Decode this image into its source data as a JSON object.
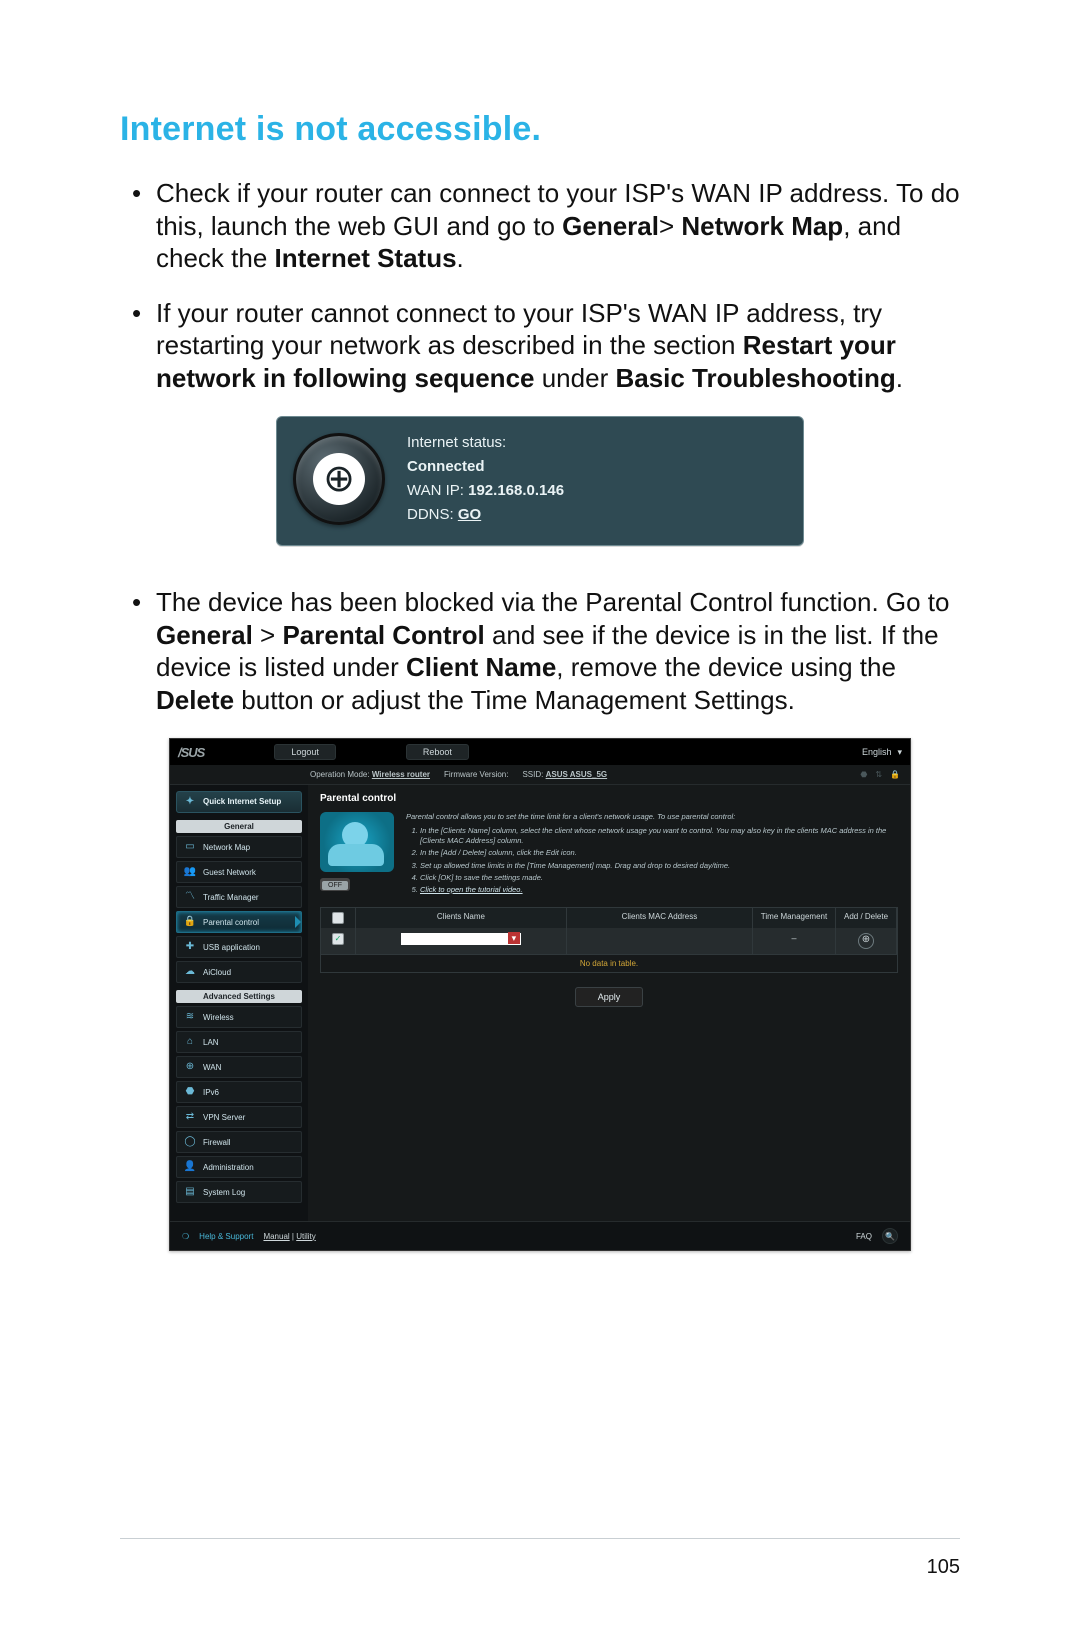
{
  "heading": "Internet is not accessible.",
  "bullets": {
    "b1": {
      "pre": "Check if your router can connect to your ISP's WAN IP address. To do this, launch the web GUI and go to ",
      "bold1": "General",
      "gt": "> ",
      "bold2": "Network Map",
      "mid": ", and check the ",
      "bold3": "Internet Status",
      "post": "."
    },
    "b2": {
      "pre": "If your router cannot connect to your ISP's WAN IP address, try restarting your network as described in the section ",
      "bold1": "Restart your network in following sequence",
      "mid": " under ",
      "bold2": "Basic Troubleshooting",
      "post": "."
    },
    "b3": {
      "pre": "The device has been blocked via the Parental Control function. Go to ",
      "bold1": "General",
      "gt": " > ",
      "bold2": "Parental Control",
      "mid1": " and see if the device is in the list. If the device is listed under ",
      "bold3": "Client Name",
      "mid2": ", remove the device using the ",
      "bold4": "Delete",
      "post": " button or adjust the Time Management Settings."
    }
  },
  "status_card": {
    "label": "Internet status:",
    "state": "Connected",
    "wan_label": "WAN IP: ",
    "wan_ip": "192.168.0.146",
    "ddns_label": "DDNS: ",
    "ddns_link": "GO"
  },
  "router": {
    "logo": "/SUS",
    "logout": "Logout",
    "reboot": "Reboot",
    "language": "English",
    "mode_label": "Operation Mode:",
    "mode_value": "Wireless router",
    "fw_label": "Firmware Version:",
    "ssid_label": "SSID:",
    "ssid_value": "ASUS  ASUS_5G",
    "qis": "Quick Internet Setup",
    "section_general": "General",
    "section_advanced": "Advanced Settings",
    "nav": {
      "network_map": "Network Map",
      "guest": "Guest Network",
      "traffic": "Traffic Manager",
      "parental": "Parental control",
      "usb": "USB application",
      "aicloud": "AiCloud",
      "wireless": "Wireless",
      "lan": "LAN",
      "wan": "WAN",
      "ipv6": "IPv6",
      "vpn": "VPN Server",
      "firewall": "Firewall",
      "admin": "Administration",
      "syslog": "System Log"
    },
    "panel_title": "Parental control",
    "switch": "OFF",
    "intro_lead": "Parental control allows you to set the time limit for a client's network usage. To use parental control:",
    "intro_steps": {
      "s1": "In the [Clients Name] column, select the client whose network usage you want to control. You may also key in the clients MAC address in the [Clients MAC Address] column.",
      "s2": "In the [Add / Delete] column, click the Edit icon.",
      "s3": "Set up allowed time limits in the [Time Management] map. Drag and drop to desired day/time.",
      "s4": "Click [OK] to save the settings made.",
      "s5": "Click to open the tutorial video."
    },
    "tbl": {
      "h_name": "Clients Name",
      "h_mac": "Clients MAC Address",
      "h_time": "Time Management",
      "h_act": "Add / Delete",
      "nodata": "No data in table."
    },
    "apply": "Apply",
    "footer": {
      "help": "Help & Support",
      "manual": "Manual",
      "sep": " | ",
      "utility": "Utility",
      "faq": "FAQ"
    }
  },
  "page_number": "105"
}
